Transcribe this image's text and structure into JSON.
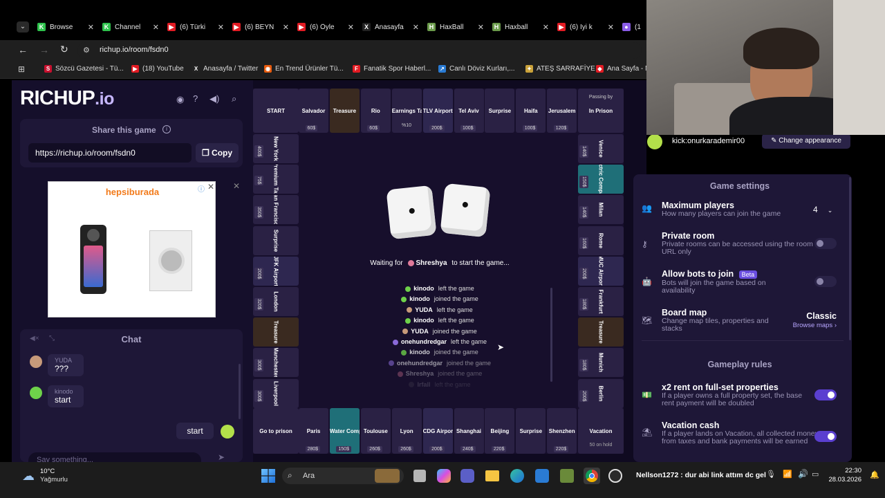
{
  "browser": {
    "tabs": [
      {
        "label": "Browse",
        "color": "#2ec24c",
        "glyph": "K"
      },
      {
        "label": "Channel",
        "color": "#2ec24c",
        "glyph": "K"
      },
      {
        "label": "(6) Türki",
        "color": "#e21b23",
        "glyph": "▶"
      },
      {
        "label": "(6) BEYN",
        "color": "#e21b23",
        "glyph": "▶"
      },
      {
        "label": "(6) Öyle",
        "color": "#e21b23",
        "glyph": "▶"
      },
      {
        "label": "Anasayfa",
        "color": "#222",
        "glyph": "X"
      },
      {
        "label": "HaxBall",
        "color": "#6a9a4a",
        "glyph": "H"
      },
      {
        "label": "Haxball",
        "color": "#6a9a4a",
        "glyph": "H"
      },
      {
        "label": "(6) İyi k",
        "color": "#e21b23",
        "glyph": "▶"
      },
      {
        "label": "(1",
        "color": "#8a5ce8",
        "glyph": "●"
      }
    ],
    "url": "richup.io/room/fsdn0",
    "bookmarks": [
      {
        "label": "Sözcü Gazetesi - Tü...",
        "color": "#c8102e",
        "glyph": "S"
      },
      {
        "label": "(18) YouTube",
        "color": "#e21b23",
        "glyph": "▶"
      },
      {
        "label": "Anasayfa / Twitter",
        "color": "#222",
        "glyph": "X"
      },
      {
        "label": "En Trend Ürünler Tü...",
        "color": "#e85a0c",
        "glyph": "◉"
      },
      {
        "label": "Fanatik Spor Haberl...",
        "color": "#e21b23",
        "glyph": "F"
      },
      {
        "label": "Canlı Döviz Kurları,...",
        "color": "#2a7bd4",
        "glyph": "↗"
      },
      {
        "label": "ATEŞ SARRAFİYE",
        "color": "#caa23a",
        "glyph": "✦"
      },
      {
        "label": "Ana Sayfa - N",
        "color": "#e21b23",
        "glyph": "◆"
      }
    ]
  },
  "app": {
    "logo": "RICHUP",
    "logo_suffix": ".io",
    "share_title": "Share this game",
    "share_url": "https://richup.io/room/fsdn0",
    "copy_label": "Copy",
    "ad_brand": "hepsiburada",
    "chat_title": "Chat",
    "chat_messages": [
      {
        "user": "YUDA",
        "text": "???",
        "color": "#c79a7a"
      },
      {
        "user": "kinodo",
        "text": "start",
        "color": "#6ed14a"
      }
    ],
    "my_message": "start",
    "chat_placeholder": "Say something..."
  },
  "board": {
    "top": [
      {
        "name": "START",
        "price": ""
      },
      {
        "name": "Salvador",
        "price": "60$"
      },
      {
        "name": "Treasure",
        "price": ""
      },
      {
        "name": "Rio",
        "price": "60$"
      },
      {
        "name": "Earnings Tax",
        "price": ""
      },
      {
        "name": "TLV Airport",
        "price": "200$"
      },
      {
        "name": "Tel Aviv",
        "price": "100$"
      },
      {
        "name": "Surprise",
        "price": ""
      },
      {
        "name": "Haifa",
        "price": "100$"
      },
      {
        "name": "Jerusalem",
        "price": "120$"
      },
      {
        "name": "In Prison",
        "price": ""
      }
    ],
    "passing_by": "Passing by",
    "tax_sub": "%10",
    "left": [
      {
        "name": "New York",
        "price": "400$"
      },
      {
        "name": "Premium Tax",
        "price": "75$"
      },
      {
        "name": "San Francisco",
        "price": "350$"
      },
      {
        "name": "Surprise",
        "price": ""
      },
      {
        "name": "JFK Airport",
        "price": "200$"
      },
      {
        "name": "London",
        "price": "320$"
      },
      {
        "name": "Treasure",
        "price": ""
      },
      {
        "name": "Manchester",
        "price": "300$"
      },
      {
        "name": "Liverpool",
        "price": "300$"
      }
    ],
    "right": [
      {
        "name": "Venice",
        "price": "140$"
      },
      {
        "name": "Electric Company",
        "price": "150$"
      },
      {
        "name": "Milan",
        "price": "140$"
      },
      {
        "name": "Rome",
        "price": "160$"
      },
      {
        "name": "MUC Airport",
        "price": "200$"
      },
      {
        "name": "Frankfurt",
        "price": "180$"
      },
      {
        "name": "Treasure",
        "price": ""
      },
      {
        "name": "Munich",
        "price": "180$"
      },
      {
        "name": "Berlin",
        "price": "200$"
      }
    ],
    "bottom": [
      {
        "name": "Go to prison",
        "price": ""
      },
      {
        "name": "Paris",
        "price": "280$"
      },
      {
        "name": "Water Company",
        "price": "150$"
      },
      {
        "name": "Toulouse",
        "price": "260$"
      },
      {
        "name": "Lyon",
        "price": "260$"
      },
      {
        "name": "CDG Airport",
        "price": "200$"
      },
      {
        "name": "Shanghai",
        "price": "240$"
      },
      {
        "name": "Beijing",
        "price": "220$"
      },
      {
        "name": "Surprise",
        "price": ""
      },
      {
        "name": "Shenzhen",
        "price": "220$"
      },
      {
        "name": "Vacation",
        "price": ""
      }
    ],
    "vacation_sub": "50 on hold",
    "waiting_prefix": "Waiting for",
    "waiting_player": "Shreshya",
    "waiting_suffix": "to start the game...",
    "log": [
      {
        "user": "kinodo",
        "action": "left the game",
        "color": "#6ed14a"
      },
      {
        "user": "kinodo",
        "action": "joined the game",
        "color": "#6ed14a"
      },
      {
        "user": "YUDA",
        "action": "left the game",
        "color": "#c79a7a"
      },
      {
        "user": "kinodo",
        "action": "left the game",
        "color": "#6ed14a"
      },
      {
        "user": "YUDA",
        "action": "joined the game",
        "color": "#c79a7a"
      },
      {
        "user": "onehundredgar",
        "action": "left the game",
        "color": "#8a6ad8"
      },
      {
        "user": "kinodo",
        "action": "joined the game",
        "color": "#6ed14a"
      },
      {
        "user": "onehundredgar",
        "action": "joined the game",
        "color": "#8a6ad8"
      },
      {
        "user": "Shreshya",
        "action": "joined the game",
        "color": "#e07a9a"
      },
      {
        "user": "Irfall",
        "action": "left the game",
        "color": "#777"
      }
    ]
  },
  "settings": {
    "player_name": "kick:onurkarademir00",
    "appearance_btn": "Change appearance",
    "title": "Game settings",
    "max_players_title": "Maximum players",
    "max_players_desc": "How many players can join the game",
    "max_players_value": "4",
    "private_title": "Private room",
    "private_desc": "Private rooms can be accessed using the room URL only",
    "bots_title": "Allow bots to join",
    "bots_badge": "Beta",
    "bots_desc": "Bots will join the game based on availability",
    "map_title": "Board map",
    "map_desc": "Change map tiles, properties and stacks",
    "map_value": "Classic",
    "map_browse": "Browse maps",
    "gameplay_title": "Gameplay rules",
    "rent_title": "x2 rent on full-set properties",
    "rent_desc": "If a player owns a full property set, the base rent payment will be doubled",
    "vacation_title": "Vacation cash",
    "vacation_desc": "If a player lands on Vacation, all collected money from taxes and bank payments will be earned",
    "accent": "#7a5cf0"
  },
  "taskbar": {
    "weather_temp": "10°C",
    "weather_desc": "Yağmurlu",
    "search": "Ara",
    "notification": "Nellson1272 : dur abi link attım dc gel",
    "time": "22:30",
    "date": "28.03.2026"
  }
}
